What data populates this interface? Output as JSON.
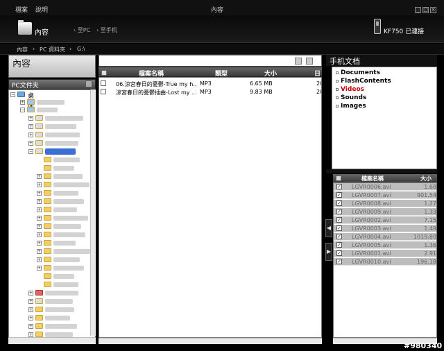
{
  "menu": {
    "file": "檔案",
    "help": "說明"
  },
  "window": {
    "title": "內容"
  },
  "header": {
    "title": "內容",
    "to_pc": "至PC",
    "to_phone": "至手机",
    "phone_name": "KF750",
    "phone_status": "已連接"
  },
  "breadcrumb": [
    "內容",
    "PC 資料夾",
    "G:\\"
  ],
  "left": {
    "title": "內容",
    "pc_folder": "PC文件夹",
    "desktop": "桌面"
  },
  "middle": {
    "columns": [
      "檔案名稱",
      "類型",
      "大小",
      "日"
    ],
    "rows": [
      {
        "name": "06.涼宮春日的憂鬱-True my h...",
        "type": "MP3",
        "size": "6.65 MB",
        "date": "20"
      },
      {
        "name": "涼宮春日的憂鬱插曲-Lost my ...",
        "type": "MP3",
        "size": "9.83 MB",
        "date": "20"
      }
    ]
  },
  "right": {
    "title": "手机文档",
    "docs": [
      {
        "label": "Documents",
        "color": "#000000"
      },
      {
        "label": "FlashContents",
        "color": "#000000"
      },
      {
        "label": "Videos",
        "color": "#cc0000"
      },
      {
        "label": "Sounds",
        "color": "#000000"
      },
      {
        "label": "Images",
        "color": "#000000"
      }
    ],
    "columns": [
      "檔案名稱",
      "大小"
    ],
    "files": [
      {
        "name": "LGVR0006.avi",
        "size": "1.68"
      },
      {
        "name": "LGVR0007.avi",
        "size": "901.54"
      },
      {
        "name": "LGVR0008.avi",
        "size": "1.27"
      },
      {
        "name": "LGVR0009.avi",
        "size": "1.33"
      },
      {
        "name": "LGVR0002.avi",
        "size": "7.15"
      },
      {
        "name": "LGVR0003.avi",
        "size": "1.49"
      },
      {
        "name": "LGVR0004.avi",
        "size": "1019.80"
      },
      {
        "name": "LGVR0005.avi",
        "size": "1.36"
      },
      {
        "name": "LGVR0001.avi",
        "size": "2.91"
      },
      {
        "name": "LGVR0010.avi",
        "size": "196.18"
      }
    ]
  },
  "watermark": "#980340",
  "icons": {
    "transfer_left": "arrow-left-icon",
    "transfer_right": "arrow-right-icon"
  }
}
